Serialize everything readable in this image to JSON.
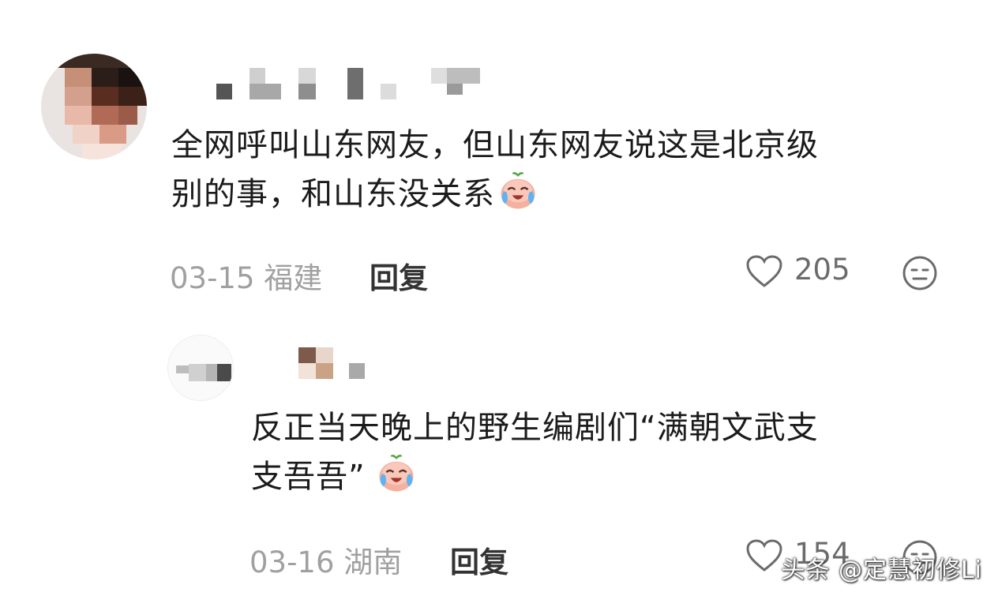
{
  "comments": [
    {
      "text_line1": "全网呼叫山东网友，但山东网友说这是北京级",
      "text_line2": "别的事，和山东没关系",
      "date": "03-15",
      "location": "福建",
      "reply_label": "回复",
      "likes": "205"
    },
    {
      "text_line1": "反正当天晚上的野生编剧们“满朝文武支",
      "text_line2": "支吾吾”",
      "date": "03-16",
      "location": "湖南",
      "reply_label": "回复",
      "likes": "154"
    }
  ],
  "watermark": "头条 @定慧初修Li",
  "icons": {
    "like": "heart-outline-icon",
    "dislike": "neutral-face-icon",
    "emoji": "crying-laughing-peach-emoji"
  }
}
